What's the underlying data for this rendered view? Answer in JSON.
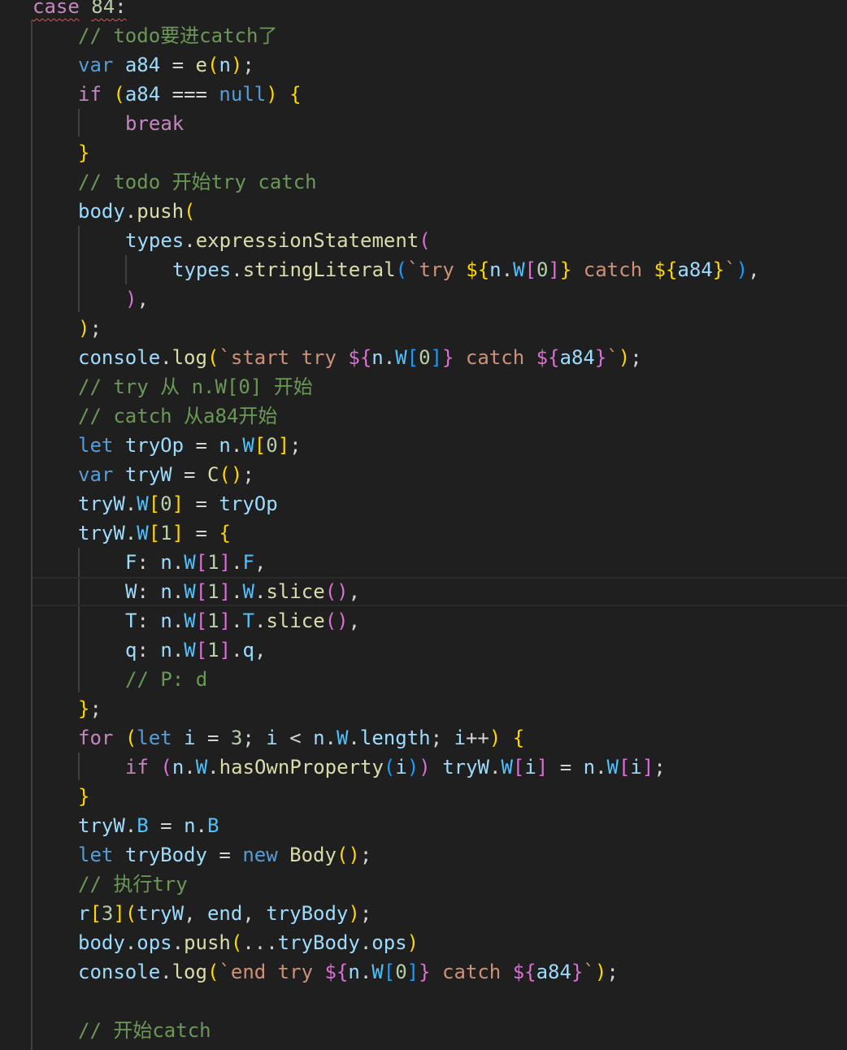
{
  "editor": {
    "theme_colors": {
      "background": "#1f1f1f",
      "keyword": "#569cd6",
      "control": "#c586c0",
      "variable": "#9cdcfe",
      "function": "#dcdcaa",
      "string": "#ce9178",
      "comment": "#6a9955",
      "bracket_1": "#ffd700",
      "bracket_2": "#da70d6",
      "bracket_3": "#179fff"
    },
    "current_line_index": 20,
    "lines": [
      [
        {
          "t": "case",
          "c": "ctl squiggle"
        },
        {
          "t": " ",
          "c": "pun"
        },
        {
          "t": "84",
          "c": "num squiggle"
        },
        {
          "t": ":",
          "c": "pun squiggle"
        }
      ],
      [
        {
          "t": "// todo要进catch了",
          "c": "cmt"
        }
      ],
      [
        {
          "t": "var",
          "c": "kw"
        },
        {
          "t": " ",
          "c": "pun"
        },
        {
          "t": "a84",
          "c": "var"
        },
        {
          "t": " = ",
          "c": "pun"
        },
        {
          "t": "e",
          "c": "fn"
        },
        {
          "t": "(",
          "c": "b1"
        },
        {
          "t": "n",
          "c": "var"
        },
        {
          "t": ")",
          "c": "b1"
        },
        {
          "t": ";",
          "c": "pun"
        }
      ],
      [
        {
          "t": "if",
          "c": "ctl"
        },
        {
          "t": " ",
          "c": "pun"
        },
        {
          "t": "(",
          "c": "b1"
        },
        {
          "t": "a84",
          "c": "var"
        },
        {
          "t": " === ",
          "c": "pun"
        },
        {
          "t": "null",
          "c": "kw"
        },
        {
          "t": ")",
          "c": "b1"
        },
        {
          "t": " ",
          "c": "pun"
        },
        {
          "t": "{",
          "c": "b1"
        }
      ],
      [
        {
          "t": "break",
          "c": "ctl"
        }
      ],
      [
        {
          "t": "}",
          "c": "b1"
        }
      ],
      [
        {
          "t": "// todo 开始try catch",
          "c": "cmt"
        }
      ],
      [
        {
          "t": "body",
          "c": "var"
        },
        {
          "t": ".",
          "c": "pun"
        },
        {
          "t": "push",
          "c": "fn"
        },
        {
          "t": "(",
          "c": "b1"
        }
      ],
      [
        {
          "t": "types",
          "c": "var"
        },
        {
          "t": ".",
          "c": "pun"
        },
        {
          "t": "expressionStatement",
          "c": "fn"
        },
        {
          "t": "(",
          "c": "b2"
        }
      ],
      [
        {
          "t": "types",
          "c": "var"
        },
        {
          "t": ".",
          "c": "pun"
        },
        {
          "t": "stringLiteral",
          "c": "fn"
        },
        {
          "t": "(",
          "c": "b3"
        },
        {
          "t": "`try ",
          "c": "str"
        },
        {
          "t": "${",
          "c": "b1"
        },
        {
          "t": "n",
          "c": "var"
        },
        {
          "t": ".",
          "c": "pun"
        },
        {
          "t": "W",
          "c": "prop"
        },
        {
          "t": "[",
          "c": "b2"
        },
        {
          "t": "0",
          "c": "num"
        },
        {
          "t": "]",
          "c": "b2"
        },
        {
          "t": "}",
          "c": "b1"
        },
        {
          "t": " catch ",
          "c": "str"
        },
        {
          "t": "${",
          "c": "b1"
        },
        {
          "t": "a84",
          "c": "var"
        },
        {
          "t": "}",
          "c": "b1"
        },
        {
          "t": "`",
          "c": "str"
        },
        {
          "t": ")",
          "c": "b3"
        },
        {
          "t": ",",
          "c": "pun"
        }
      ],
      [
        {
          "t": ")",
          "c": "b2"
        },
        {
          "t": ",",
          "c": "pun"
        }
      ],
      [
        {
          "t": ")",
          "c": "b1"
        },
        {
          "t": ";",
          "c": "pun"
        }
      ],
      [
        {
          "t": "console",
          "c": "var"
        },
        {
          "t": ".",
          "c": "pun"
        },
        {
          "t": "log",
          "c": "fn"
        },
        {
          "t": "(",
          "c": "b1"
        },
        {
          "t": "`start try ",
          "c": "str"
        },
        {
          "t": "${",
          "c": "b2"
        },
        {
          "t": "n",
          "c": "var"
        },
        {
          "t": ".",
          "c": "pun"
        },
        {
          "t": "W",
          "c": "prop"
        },
        {
          "t": "[",
          "c": "b3"
        },
        {
          "t": "0",
          "c": "num"
        },
        {
          "t": "]",
          "c": "b3"
        },
        {
          "t": "}",
          "c": "b2"
        },
        {
          "t": " catch ",
          "c": "str"
        },
        {
          "t": "${",
          "c": "b2"
        },
        {
          "t": "a84",
          "c": "var"
        },
        {
          "t": "}",
          "c": "b2"
        },
        {
          "t": "`",
          "c": "str"
        },
        {
          "t": ")",
          "c": "b1"
        },
        {
          "t": ";",
          "c": "pun"
        }
      ],
      [
        {
          "t": "// try 从 n.W[0] 开始",
          "c": "cmt"
        }
      ],
      [
        {
          "t": "// catch 从a84开始",
          "c": "cmt"
        }
      ],
      [
        {
          "t": "let",
          "c": "kw"
        },
        {
          "t": " ",
          "c": "pun"
        },
        {
          "t": "tryOp",
          "c": "var"
        },
        {
          "t": " = ",
          "c": "pun"
        },
        {
          "t": "n",
          "c": "var"
        },
        {
          "t": ".",
          "c": "pun"
        },
        {
          "t": "W",
          "c": "prop"
        },
        {
          "t": "[",
          "c": "b1"
        },
        {
          "t": "0",
          "c": "num"
        },
        {
          "t": "]",
          "c": "b1"
        },
        {
          "t": ";",
          "c": "pun"
        }
      ],
      [
        {
          "t": "var",
          "c": "kw"
        },
        {
          "t": " ",
          "c": "pun"
        },
        {
          "t": "tryW",
          "c": "var"
        },
        {
          "t": " = ",
          "c": "pun"
        },
        {
          "t": "C",
          "c": "fn"
        },
        {
          "t": "()",
          "c": "b1"
        },
        {
          "t": ";",
          "c": "pun"
        }
      ],
      [
        {
          "t": "tryW",
          "c": "var"
        },
        {
          "t": ".",
          "c": "pun"
        },
        {
          "t": "W",
          "c": "prop"
        },
        {
          "t": "[",
          "c": "b1"
        },
        {
          "t": "0",
          "c": "num"
        },
        {
          "t": "]",
          "c": "b1"
        },
        {
          "t": " = ",
          "c": "pun"
        },
        {
          "t": "tryOp",
          "c": "var"
        }
      ],
      [
        {
          "t": "tryW",
          "c": "var"
        },
        {
          "t": ".",
          "c": "pun"
        },
        {
          "t": "W",
          "c": "prop"
        },
        {
          "t": "[",
          "c": "b1"
        },
        {
          "t": "1",
          "c": "num"
        },
        {
          "t": "]",
          "c": "b1"
        },
        {
          "t": " = ",
          "c": "pun"
        },
        {
          "t": "{",
          "c": "b1"
        }
      ],
      [
        {
          "t": "F",
          "c": "var"
        },
        {
          "t": ": ",
          "c": "pun"
        },
        {
          "t": "n",
          "c": "var"
        },
        {
          "t": ".",
          "c": "pun"
        },
        {
          "t": "W",
          "c": "prop"
        },
        {
          "t": "[",
          "c": "b2"
        },
        {
          "t": "1",
          "c": "num"
        },
        {
          "t": "]",
          "c": "b2"
        },
        {
          "t": ".",
          "c": "pun"
        },
        {
          "t": "F",
          "c": "prop"
        },
        {
          "t": ",",
          "c": "pun"
        }
      ],
      [
        {
          "t": "W",
          "c": "var"
        },
        {
          "t": ": ",
          "c": "pun"
        },
        {
          "t": "n",
          "c": "var"
        },
        {
          "t": ".",
          "c": "pun"
        },
        {
          "t": "W",
          "c": "prop"
        },
        {
          "t": "[",
          "c": "b2"
        },
        {
          "t": "1",
          "c": "num"
        },
        {
          "t": "]",
          "c": "b2"
        },
        {
          "t": ".",
          "c": "pun"
        },
        {
          "t": "W",
          "c": "prop"
        },
        {
          "t": ".",
          "c": "pun"
        },
        {
          "t": "slice",
          "c": "fn"
        },
        {
          "t": "()",
          "c": "b2"
        },
        {
          "t": ",",
          "c": "pun"
        }
      ],
      [
        {
          "t": "T",
          "c": "var"
        },
        {
          "t": ": ",
          "c": "pun"
        },
        {
          "t": "n",
          "c": "var"
        },
        {
          "t": ".",
          "c": "pun"
        },
        {
          "t": "W",
          "c": "prop"
        },
        {
          "t": "[",
          "c": "b2"
        },
        {
          "t": "1",
          "c": "num"
        },
        {
          "t": "]",
          "c": "b2"
        },
        {
          "t": ".",
          "c": "pun"
        },
        {
          "t": "T",
          "c": "prop"
        },
        {
          "t": ".",
          "c": "pun"
        },
        {
          "t": "slice",
          "c": "fn"
        },
        {
          "t": "()",
          "c": "b2"
        },
        {
          "t": ",",
          "c": "pun"
        }
      ],
      [
        {
          "t": "q",
          "c": "var"
        },
        {
          "t": ": ",
          "c": "pun"
        },
        {
          "t": "n",
          "c": "var"
        },
        {
          "t": ".",
          "c": "pun"
        },
        {
          "t": "W",
          "c": "prop"
        },
        {
          "t": "[",
          "c": "b2"
        },
        {
          "t": "1",
          "c": "num"
        },
        {
          "t": "]",
          "c": "b2"
        },
        {
          "t": ".",
          "c": "pun"
        },
        {
          "t": "q",
          "c": "var"
        },
        {
          "t": ",",
          "c": "pun"
        }
      ],
      [
        {
          "t": "// P: d",
          "c": "cmt"
        }
      ],
      [
        {
          "t": "}",
          "c": "b1"
        },
        {
          "t": ";",
          "c": "pun"
        }
      ],
      [
        {
          "t": "for",
          "c": "ctl"
        },
        {
          "t": " ",
          "c": "pun"
        },
        {
          "t": "(",
          "c": "b1"
        },
        {
          "t": "let",
          "c": "kw"
        },
        {
          "t": " ",
          "c": "pun"
        },
        {
          "t": "i",
          "c": "var"
        },
        {
          "t": " = ",
          "c": "pun"
        },
        {
          "t": "3",
          "c": "num"
        },
        {
          "t": "; ",
          "c": "pun"
        },
        {
          "t": "i",
          "c": "var"
        },
        {
          "t": " < ",
          "c": "pun"
        },
        {
          "t": "n",
          "c": "var"
        },
        {
          "t": ".",
          "c": "pun"
        },
        {
          "t": "W",
          "c": "prop"
        },
        {
          "t": ".",
          "c": "pun"
        },
        {
          "t": "length",
          "c": "var"
        },
        {
          "t": "; ",
          "c": "pun"
        },
        {
          "t": "i",
          "c": "var"
        },
        {
          "t": "++",
          "c": "pun"
        },
        {
          "t": ")",
          "c": "b1"
        },
        {
          "t": " ",
          "c": "pun"
        },
        {
          "t": "{",
          "c": "b1"
        }
      ],
      [
        {
          "t": "if",
          "c": "ctl"
        },
        {
          "t": " ",
          "c": "pun"
        },
        {
          "t": "(",
          "c": "b2"
        },
        {
          "t": "n",
          "c": "var"
        },
        {
          "t": ".",
          "c": "pun"
        },
        {
          "t": "W",
          "c": "prop"
        },
        {
          "t": ".",
          "c": "pun"
        },
        {
          "t": "hasOwnProperty",
          "c": "fn"
        },
        {
          "t": "(",
          "c": "b3"
        },
        {
          "t": "i",
          "c": "var"
        },
        {
          "t": ")",
          "c": "b3"
        },
        {
          "t": ")",
          "c": "b2"
        },
        {
          "t": " ",
          "c": "pun"
        },
        {
          "t": "tryW",
          "c": "var"
        },
        {
          "t": ".",
          "c": "pun"
        },
        {
          "t": "W",
          "c": "prop"
        },
        {
          "t": "[",
          "c": "b2"
        },
        {
          "t": "i",
          "c": "var"
        },
        {
          "t": "]",
          "c": "b2"
        },
        {
          "t": " = ",
          "c": "pun"
        },
        {
          "t": "n",
          "c": "var"
        },
        {
          "t": ".",
          "c": "pun"
        },
        {
          "t": "W",
          "c": "prop"
        },
        {
          "t": "[",
          "c": "b2"
        },
        {
          "t": "i",
          "c": "var"
        },
        {
          "t": "]",
          "c": "b2"
        },
        {
          "t": ";",
          "c": "pun"
        }
      ],
      [
        {
          "t": "}",
          "c": "b1"
        }
      ],
      [
        {
          "t": "tryW",
          "c": "var"
        },
        {
          "t": ".",
          "c": "pun"
        },
        {
          "t": "B",
          "c": "prop"
        },
        {
          "t": " = ",
          "c": "pun"
        },
        {
          "t": "n",
          "c": "var"
        },
        {
          "t": ".",
          "c": "pun"
        },
        {
          "t": "B",
          "c": "prop"
        }
      ],
      [
        {
          "t": "let",
          "c": "kw"
        },
        {
          "t": " ",
          "c": "pun"
        },
        {
          "t": "tryBody",
          "c": "var"
        },
        {
          "t": " = ",
          "c": "pun"
        },
        {
          "t": "new",
          "c": "kw"
        },
        {
          "t": " ",
          "c": "pun"
        },
        {
          "t": "Body",
          "c": "fn"
        },
        {
          "t": "()",
          "c": "b1"
        },
        {
          "t": ";",
          "c": "pun"
        }
      ],
      [
        {
          "t": "// 执行try",
          "c": "cmt"
        }
      ],
      [
        {
          "t": "r",
          "c": "var"
        },
        {
          "t": "[",
          "c": "b1"
        },
        {
          "t": "3",
          "c": "num"
        },
        {
          "t": "]",
          "c": "b1"
        },
        {
          "t": "(",
          "c": "b1"
        },
        {
          "t": "tryW",
          "c": "var"
        },
        {
          "t": ", ",
          "c": "pun"
        },
        {
          "t": "end",
          "c": "var"
        },
        {
          "t": ", ",
          "c": "pun"
        },
        {
          "t": "tryBody",
          "c": "var"
        },
        {
          "t": ")",
          "c": "b1"
        },
        {
          "t": ";",
          "c": "pun"
        }
      ],
      [
        {
          "t": "body",
          "c": "var"
        },
        {
          "t": ".",
          "c": "pun"
        },
        {
          "t": "ops",
          "c": "var"
        },
        {
          "t": ".",
          "c": "pun"
        },
        {
          "t": "push",
          "c": "fn"
        },
        {
          "t": "(",
          "c": "b1"
        },
        {
          "t": "...",
          "c": "pun"
        },
        {
          "t": "tryBody",
          "c": "var"
        },
        {
          "t": ".",
          "c": "pun"
        },
        {
          "t": "ops",
          "c": "var"
        },
        {
          "t": ")",
          "c": "b1"
        }
      ],
      [
        {
          "t": "console",
          "c": "var"
        },
        {
          "t": ".",
          "c": "pun"
        },
        {
          "t": "log",
          "c": "fn"
        },
        {
          "t": "(",
          "c": "b1"
        },
        {
          "t": "`end try ",
          "c": "str"
        },
        {
          "t": "${",
          "c": "b2"
        },
        {
          "t": "n",
          "c": "var"
        },
        {
          "t": ".",
          "c": "pun"
        },
        {
          "t": "W",
          "c": "prop"
        },
        {
          "t": "[",
          "c": "b3"
        },
        {
          "t": "0",
          "c": "num"
        },
        {
          "t": "]",
          "c": "b3"
        },
        {
          "t": "}",
          "c": "b2"
        },
        {
          "t": " catch ",
          "c": "str"
        },
        {
          "t": "${",
          "c": "b2"
        },
        {
          "t": "a84",
          "c": "var"
        },
        {
          "t": "}",
          "c": "b2"
        },
        {
          "t": "`",
          "c": "str"
        },
        {
          "t": ")",
          "c": "b1"
        },
        {
          "t": ";",
          "c": "pun"
        }
      ],
      [],
      [
        {
          "t": "// 开始catch",
          "c": "cmt"
        }
      ]
    ]
  }
}
